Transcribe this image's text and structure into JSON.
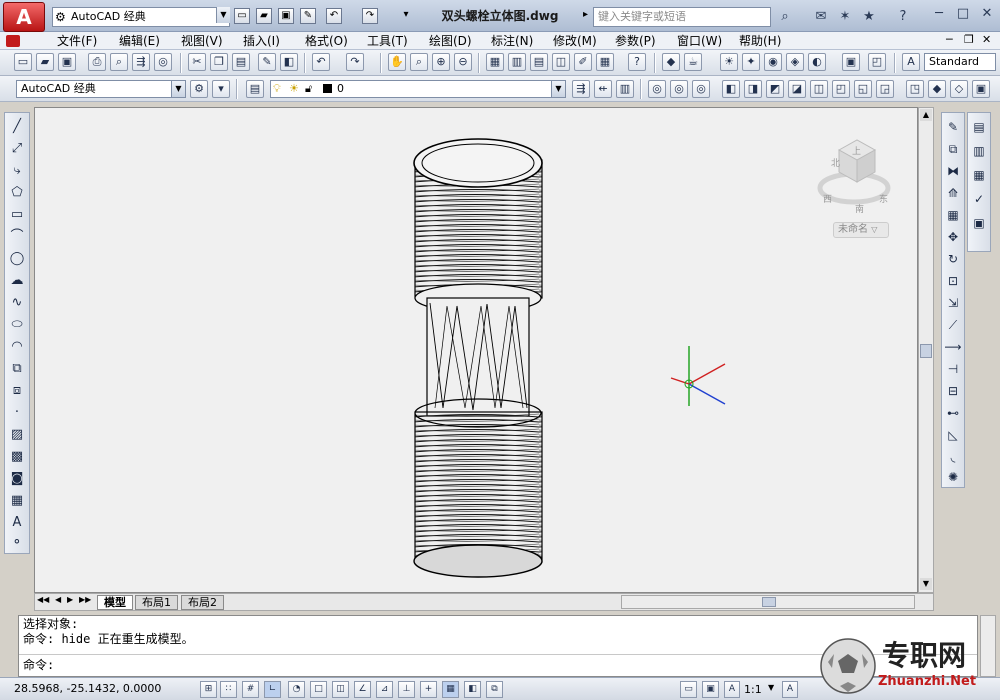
{
  "title": {
    "app_logo": "A",
    "workspace": "AutoCAD 经典",
    "document_title": "双头螺栓立体图.dwg",
    "search_placeholder": "键入关键字或短语"
  },
  "menu": [
    "文件(F)",
    "编辑(E)",
    "视图(V)",
    "插入(I)",
    "格式(O)",
    "工具(T)",
    "绘图(D)",
    "标注(N)",
    "修改(M)",
    "参数(P)",
    "窗口(W)",
    "帮助(H)"
  ],
  "toolbar2": {
    "text_style": "Standard"
  },
  "toolbar3": {
    "workspace": "AutoCAD 经典",
    "layer": "0"
  },
  "viewcube": {
    "top_label": "上",
    "north_label": "北",
    "west_label": "西",
    "south_label": "南",
    "east_label": "东",
    "ucs_label": "未命名"
  },
  "layout_tabs": [
    "模型",
    "布局1",
    "布局2"
  ],
  "command": {
    "line1": "选择对象:",
    "line2": "命令: hide 正在重生成模型。",
    "prompt": "命令:"
  },
  "status": {
    "coordinates": "28.5968, -25.1432, 0.0000",
    "scale": "1:1"
  },
  "watermark": {
    "cn": "专职网",
    "en": "Zhuanzhi.Net"
  },
  "colors": {
    "x_axis": "#d02020",
    "y_axis": "#18a018",
    "z_axis": "#2040d0",
    "app_red": "#c21b1b"
  }
}
